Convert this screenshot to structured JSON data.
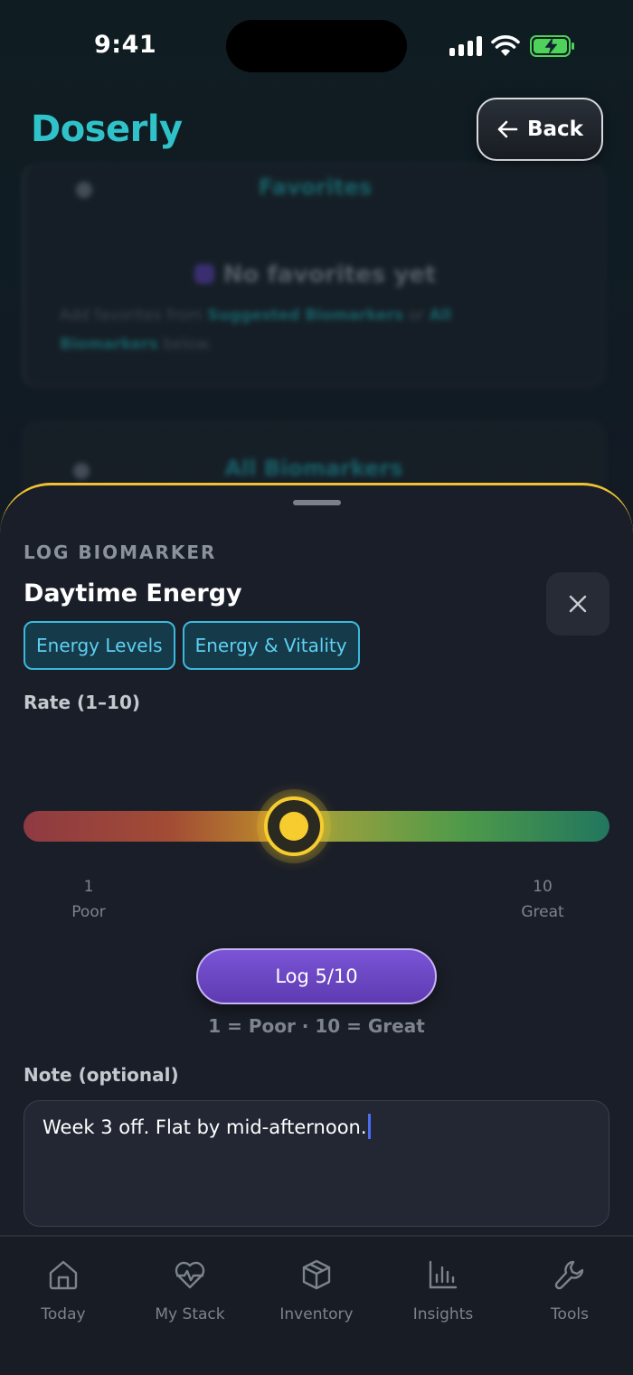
{
  "status_bar": {
    "time": "9:41"
  },
  "header": {
    "app_title": "Doserly",
    "back_label": "Back"
  },
  "background": {
    "favorites_title": "Favorites",
    "favorites_empty": "No favorites yet",
    "favorites_hint_prefix": "Add favorites from ",
    "favorites_hint_link1": "Suggested Biomarkers",
    "favorites_hint_mid": " or ",
    "favorites_hint_link2": "All Biomarkers",
    "favorites_hint_suffix": " below.",
    "all_title": "All Biomarkers"
  },
  "sheet": {
    "eyebrow": "LOG BIOMARKER",
    "title": "Daytime Energy",
    "tags": [
      "Energy Levels",
      "Energy & Vitality"
    ],
    "rate_label": "Rate (1–10)",
    "slider": {
      "min": 1,
      "max": 10,
      "value": 5,
      "min_num": "1",
      "min_text": "Poor",
      "max_num": "10",
      "max_text": "Great"
    },
    "log_button_label": "Log 5/10",
    "scale_hint": "1 = Poor · 10 = Great",
    "note_label": "Note (optional)",
    "note_value": "Week 3 off. Flat by mid-afternoon."
  },
  "tab_bar": {
    "items": [
      {
        "label": "Today",
        "icon": "home-icon"
      },
      {
        "label": "My Stack",
        "icon": "heart-pulse-icon"
      },
      {
        "label": "Inventory",
        "icon": "box-icon"
      },
      {
        "label": "Insights",
        "icon": "bar-chart-icon"
      },
      {
        "label": "Tools",
        "icon": "wrench-icon"
      }
    ]
  },
  "colors": {
    "brand": "#2fc2c8",
    "accent": "#f6cc2e",
    "primary_button": "#6a46c4",
    "tag": "#3bb9dd"
  }
}
